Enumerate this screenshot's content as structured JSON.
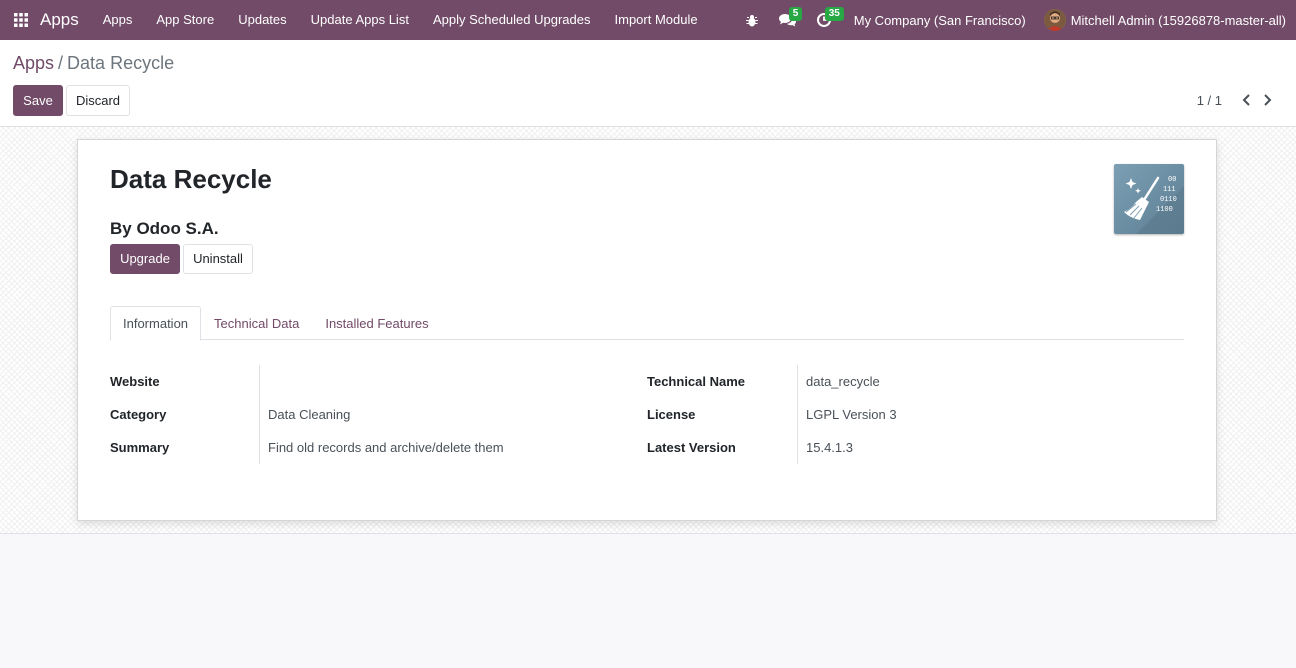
{
  "navbar": {
    "brand": "Apps",
    "menu": [
      {
        "label": "Apps"
      },
      {
        "label": "App Store"
      },
      {
        "label": "Updates"
      },
      {
        "label": "Update Apps List"
      },
      {
        "label": "Apply Scheduled Upgrades"
      },
      {
        "label": "Import Module"
      }
    ],
    "messages_count": "5",
    "activities_count": "35",
    "company": "My Company (San Francisco)",
    "user": "Mitchell Admin (15926878-master-all)",
    "icons": [
      "apps-grid-icon",
      "bug-icon",
      "chat-icon",
      "clock-icon"
    ]
  },
  "breadcrumb": {
    "parent": "Apps",
    "separator": "/",
    "current": "Data Recycle"
  },
  "actions": {
    "save": "Save",
    "discard": "Discard"
  },
  "pager": {
    "value": "1 / 1"
  },
  "module": {
    "title": "Data Recycle",
    "author": "By Odoo S.A.",
    "upgrade": "Upgrade",
    "uninstall": "Uninstall",
    "icon": "data-recycle-app-icon"
  },
  "tabs": [
    {
      "label": "Information",
      "active": true
    },
    {
      "label": "Technical Data",
      "active": false
    },
    {
      "label": "Installed Features",
      "active": false
    }
  ],
  "info": {
    "left": [
      {
        "label": "Website",
        "value": ""
      },
      {
        "label": "Category",
        "value": "Data Cleaning"
      },
      {
        "label": "Summary",
        "value": "Find old records and archive/delete them"
      }
    ],
    "right": [
      {
        "label": "Technical Name",
        "value": "data_recycle"
      },
      {
        "label": "License",
        "value": "LGPL Version 3"
      },
      {
        "label": "Latest Version",
        "value": "15.4.1.3"
      }
    ]
  },
  "colors": {
    "brand": "#714b67",
    "badge": "#28a745"
  }
}
